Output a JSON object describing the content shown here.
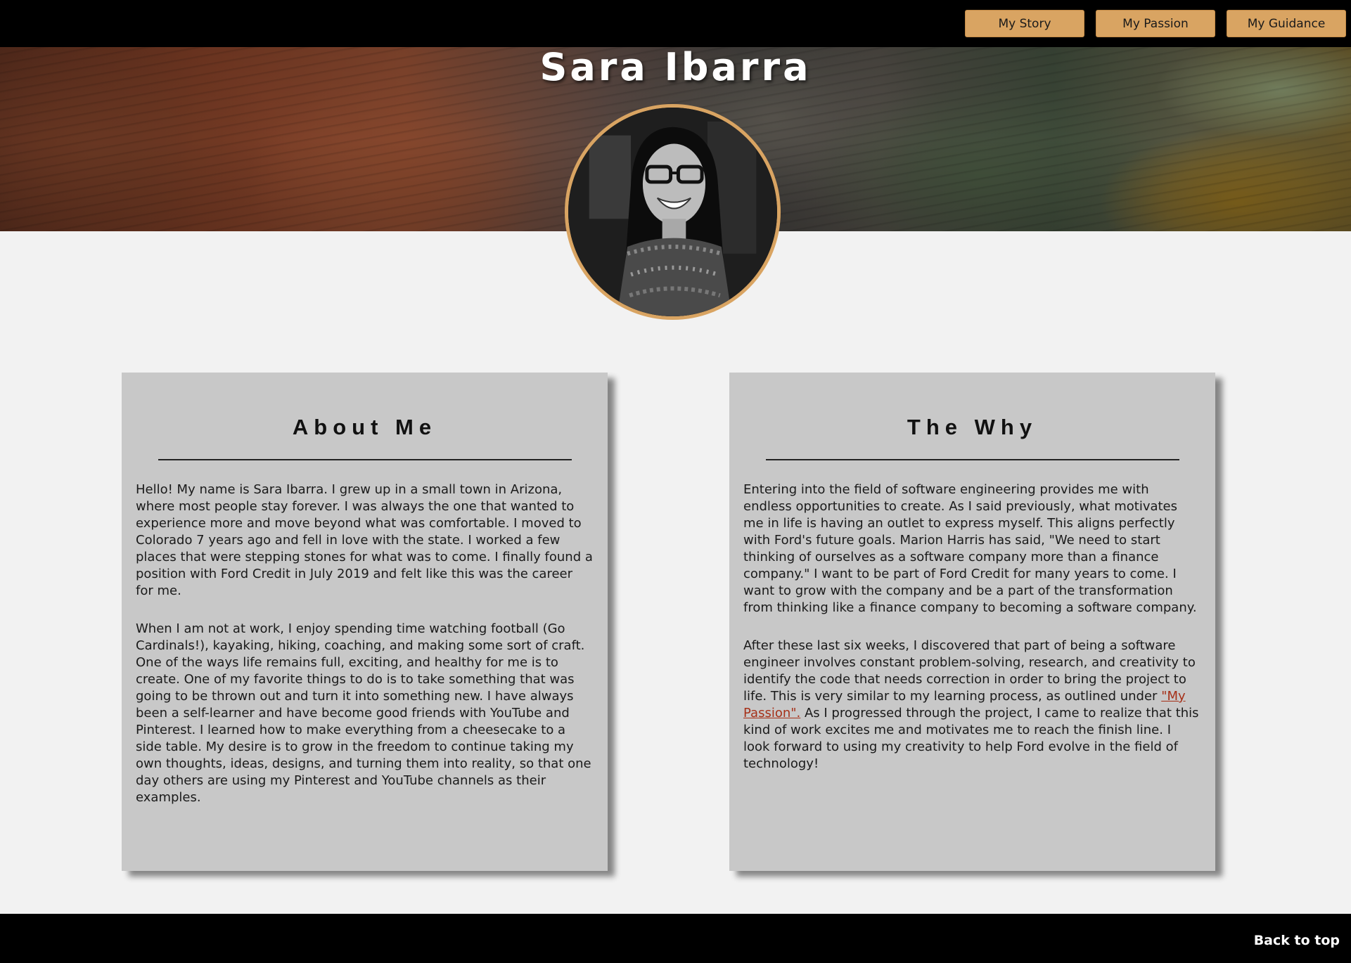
{
  "nav": {
    "items": [
      {
        "label": "My Story"
      },
      {
        "label": "My Passion"
      },
      {
        "label": "My Guidance"
      }
    ]
  },
  "header": {
    "title": "Sara Ibarra"
  },
  "about": {
    "title": "About Me",
    "paragraphs": [
      "Hello! My name is Sara Ibarra. I grew up in a small town in Arizona, where most people stay forever. I was always the one that wanted to experience more and move beyond what was comfortable. I moved to Colorado 7 years ago and fell in love with the state. I worked a few places that were stepping stones for what was to come. I finally found a position with Ford Credit in July 2019 and felt like this was the career for me.",
      "When I am not at work, I enjoy spending time watching football (Go Cardinals!), kayaking, hiking, coaching, and making some sort of craft. One of the ways life remains full, exciting, and healthy for me is to create. One of my favorite things to do is to take something that was going to be thrown out and turn it into something new. I have always been a self-learner and have become good friends with YouTube and Pinterest. I learned how to make everything from a cheesecake to a side table. My desire is to grow in the freedom to continue taking my own thoughts, ideas, designs, and turning them into reality, so that one day others are using my Pinterest and YouTube channels as their examples."
    ]
  },
  "why": {
    "title": "The Why",
    "paragraph1": "Entering into the field of software engineering provides me with endless opportunities to create. As I said previously, what motivates me in life is having an outlet to express myself. This aligns perfectly with Ford's future goals. Marion Harris has said, \"We need to start thinking of ourselves as a software company more than a finance company.\" I want to be part of Ford Credit for many years to come. I want to grow with the company and be a part of the transformation from thinking like a finance company to becoming a software company.",
    "paragraph2_before": "After these last six weeks, I discovered that part of being a software engineer involves constant problem-solving, research, and creativity to identify the code that needs correction in order to bring the project to life. This is very similar to my learning process, as outlined under ",
    "paragraph2_link": "\"My Passion\".",
    "paragraph2_after": " As I progressed through the project, I came to realize that this kind of work excites me and motivates me to reach the finish line. I look forward to using my creativity to help Ford evolve in the field of technology!"
  },
  "footer": {
    "back_to_top": "Back to top"
  },
  "colors": {
    "accent": "#d9a462",
    "card_bg": "#c8c8c8",
    "link": "#a63018"
  }
}
